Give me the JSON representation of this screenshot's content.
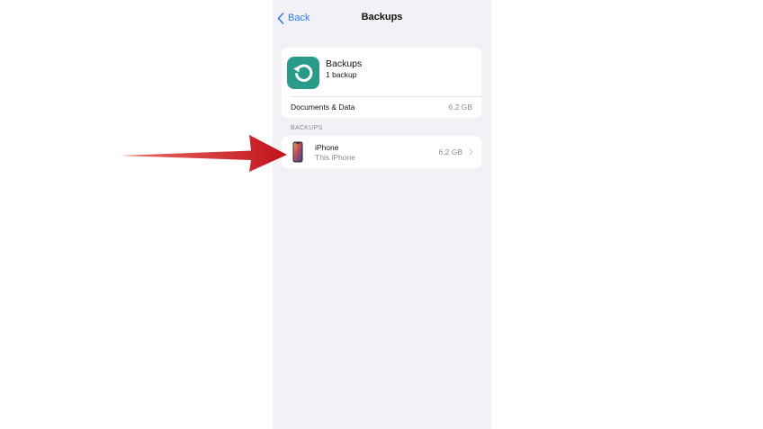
{
  "nav": {
    "back_label": "Back",
    "title": "Backups"
  },
  "summary": {
    "app_name": "Backups",
    "backup_count": "1 backup",
    "icon": "restore-icon",
    "icon_color": "#2a9a8b",
    "documents_label": "Documents & Data",
    "documents_size": "6.2 GB"
  },
  "backups_section": {
    "header": "BACKUPS",
    "items": [
      {
        "name": "iPhone",
        "subtitle": "This iPhone",
        "size": "6.2 GB",
        "icon": "iphone-icon"
      }
    ]
  },
  "annotation": {
    "icon": "red-arrow-pointer",
    "color": "#d4191a"
  },
  "colors": {
    "accent": "#2f7cf6",
    "background": "#f1f1f6"
  }
}
